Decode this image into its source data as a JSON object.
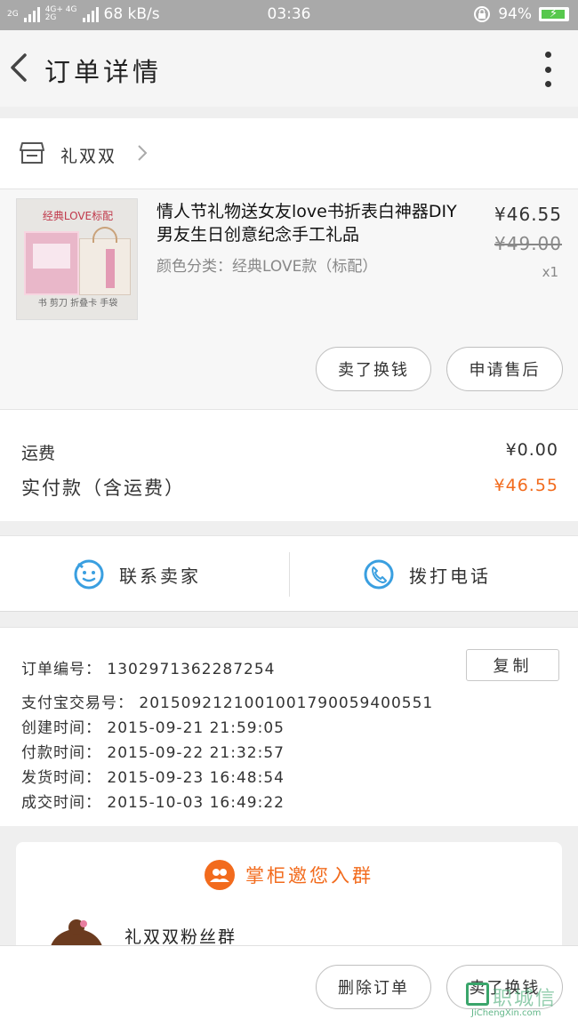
{
  "status_bar": {
    "sim1": "2G",
    "sim2_top": "4G+ 4G",
    "sim2_bottom": "2G",
    "net_speed": "68 kB/s",
    "time": "03:36",
    "battery": "94%",
    "battery_level": 0.94
  },
  "header": {
    "title": "订单详情"
  },
  "shop": {
    "name": "礼双双"
  },
  "item": {
    "thumb_top_text": "经典LOVE标配",
    "thumb_bottom_text": "书 剪刀 折叠卡 手袋",
    "name": "情人节礼物送女友love书折表白神器DIY男友生日创意纪念手工礼品",
    "spec": "颜色分类：经典LOVE款（标配）",
    "price": "¥46.55",
    "original_price": "¥49.00",
    "quantity": "x1",
    "buttons": {
      "refund": "卖了换钱",
      "after_sale": "申请售后"
    }
  },
  "fees": {
    "shipping_label": "运费",
    "shipping_value": "¥0.00",
    "total_label": "实付款（含运费）",
    "total_value": "¥46.55"
  },
  "contact": {
    "seller": "联系卖家",
    "call": "拨打电话"
  },
  "order_info": {
    "order_no": "订单编号： 1302971362287254",
    "alipay_no": "支付宝交易号： 2015092121001001790059400551",
    "created": "创建时间： 2015-09-21 21:59:05",
    "paid": "付款时间： 2015-09-22 21:32:57",
    "shipped": "发货时间： 2015-09-23 16:48:54",
    "completed": "成交时间： 2015-10-03 16:49:22",
    "copy_label": "复制"
  },
  "group": {
    "title": "掌柜邀您入群",
    "name": "礼双双粉丝群"
  },
  "bottom": {
    "delete": "删除订单",
    "sell": "卖了换钱"
  },
  "watermark": {
    "text": "职城信",
    "url": "JiChengXin.com"
  },
  "colors": {
    "accent": "#f26b1d",
    "icon_blue": "#3a9fe0",
    "status_bar": "#a9a9a9"
  }
}
